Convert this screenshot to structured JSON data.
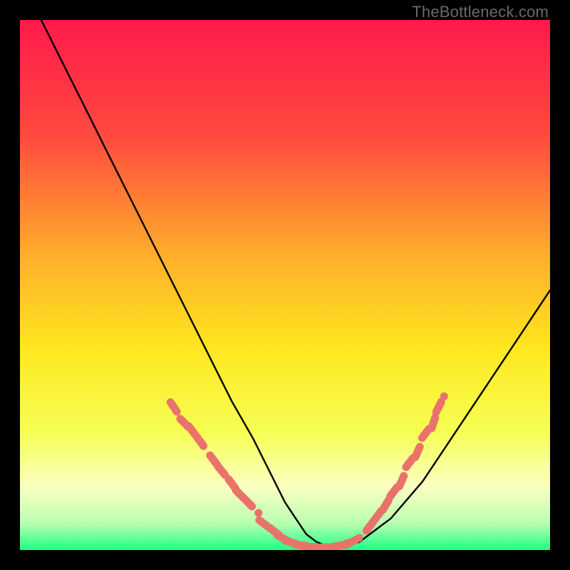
{
  "watermark": "TheBottleneck.com",
  "colors": {
    "gradient_top": "#ff1a4b",
    "gradient_mid_upper": "#ff6a3a",
    "gradient_mid": "#ffd21f",
    "gradient_mid_lower": "#f8ff4a",
    "gradient_pale": "#fbffbf",
    "gradient_bottom": "#22ff88",
    "curve": "#000000",
    "dots": "#e9736b",
    "frame_bg": "#000000"
  },
  "chart_data": {
    "type": "line",
    "title": "",
    "xlabel": "",
    "ylabel": "",
    "xlim": [
      0,
      100
    ],
    "ylim": [
      0,
      100
    ],
    "series": [
      {
        "name": "bottleneck-curve",
        "x": [
          4,
          8,
          12,
          16,
          20,
          24,
          28,
          32,
          36,
          40,
          44,
          48,
          50,
          52,
          54,
          56,
          58,
          60,
          64,
          70,
          76,
          82,
          88,
          94,
          100
        ],
        "y": [
          100,
          92,
          84,
          76,
          68,
          60,
          52,
          44,
          36,
          28,
          21,
          13,
          9,
          6,
          3,
          1.5,
          0.7,
          0.5,
          1.5,
          6,
          13,
          22,
          31,
          40,
          49
        ]
      }
    ],
    "dot_clusters": [
      {
        "name": "left-descent",
        "points_xy": [
          [
            29,
            27
          ],
          [
            31,
            24
          ],
          [
            32.5,
            22.5
          ],
          [
            34,
            20.5
          ],
          [
            36.5,
            17
          ],
          [
            38,
            15
          ],
          [
            40,
            12.5
          ],
          [
            41.5,
            10.5
          ],
          [
            43,
            9
          ],
          [
            45,
            7
          ]
        ]
      },
      {
        "name": "valley-floor",
        "points_xy": [
          [
            46,
            5
          ],
          [
            48,
            3.5
          ],
          [
            49.5,
            2.3
          ],
          [
            51,
            1.5
          ],
          [
            53,
            0.9
          ],
          [
            55,
            0.6
          ],
          [
            57,
            0.5
          ],
          [
            59,
            0.6
          ],
          [
            61,
            1
          ],
          [
            62.5,
            1.5
          ],
          [
            64,
            2.3
          ]
        ]
      },
      {
        "name": "right-ascent",
        "points_xy": [
          [
            66,
            4.5
          ],
          [
            67.5,
            6.5
          ],
          [
            69,
            8.5
          ],
          [
            70.5,
            11
          ],
          [
            72,
            13
          ],
          [
            73.5,
            16.5
          ],
          [
            75,
            18.5
          ],
          [
            76.5,
            22
          ],
          [
            78,
            24
          ],
          [
            79,
            27
          ],
          [
            80,
            29
          ]
        ]
      }
    ]
  }
}
